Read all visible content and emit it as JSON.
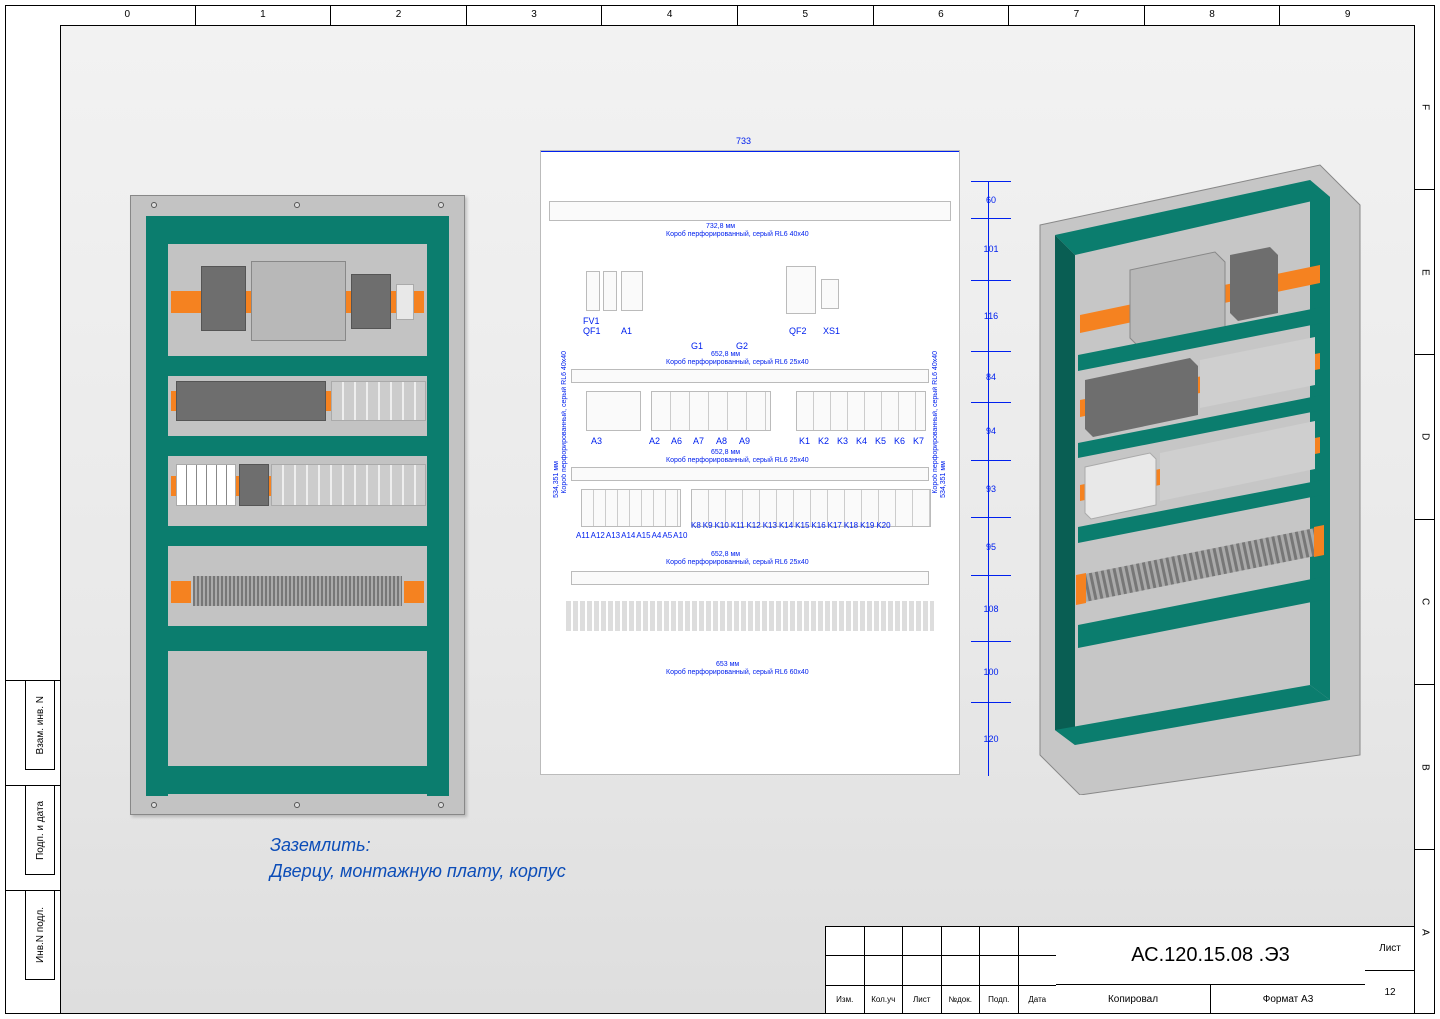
{
  "scale_top": [
    "0",
    "1",
    "2",
    "3",
    "4",
    "5",
    "6",
    "7",
    "8",
    "9"
  ],
  "scale_right": [
    "F",
    "E",
    "D",
    "C",
    "B",
    "A"
  ],
  "left_labels": {
    "l1": "Взам. инв. N",
    "l2": "Подп. и дата",
    "l3": "Инв.N подл."
  },
  "center": {
    "overall_width": "733",
    "duct_top": {
      "len": "732,8 мм",
      "desc": "Короб перфорированный, серый RL6 40x40"
    },
    "duct_mid1": {
      "len": "652,8 мм",
      "desc": "Короб перфорированный, серый RL6 25x40"
    },
    "duct_mid2": {
      "len": "652,8 мм",
      "desc": "Короб перфорированный, серый RL6 25x40"
    },
    "duct_mid3": {
      "len": "652,8 мм",
      "desc": "Короб перфорированный, серый RL6 25x40"
    },
    "duct_bot": {
      "len": "653 мм",
      "desc": "Короб перфорированный, серый RL6 60x40"
    },
    "duct_side_l": {
      "len": "534,351 мм",
      "desc": "Короб перфорированный, серый RL6 40x40"
    },
    "duct_side_r": {
      "len": "534,351 мм",
      "desc": "Короб перфорированный, серый RL6 40x40"
    },
    "row1_tags": [
      "FV1",
      "QF1",
      "A1",
      "G1",
      "G2",
      "QF2",
      "XS1"
    ],
    "row2_tags": [
      "A3",
      "A2",
      "A6",
      "A7",
      "A8",
      "A9",
      "K1",
      "K2",
      "K3",
      "K4",
      "K5",
      "K6",
      "K7"
    ],
    "row3_left": [
      "A11",
      "A12",
      "A13",
      "A14",
      "A15",
      "A4",
      "A5",
      "A10"
    ],
    "row3_right": [
      "K8",
      "K9",
      "K10",
      "K11",
      "K12",
      "K13",
      "K14",
      "K15",
      "K16",
      "K17",
      "K18",
      "K19",
      "K20"
    ],
    "heights": [
      "60",
      "101",
      "116",
      "84",
      "94",
      "93",
      "95",
      "108",
      "100",
      "120"
    ]
  },
  "note": {
    "t1": "Заземлить:",
    "t2": "Дверцу, монтажную плату, корпус"
  },
  "titleblock": {
    "cols": [
      "Изм.",
      "Кол.уч",
      "Лист",
      "№док.",
      "Подп.",
      "Дата"
    ],
    "doc": "АС.120.15.08  .Э3",
    "copy": "Копировал",
    "format": "Формат   А3",
    "sheet_lbl": "Лист",
    "sheet_no": "12"
  }
}
